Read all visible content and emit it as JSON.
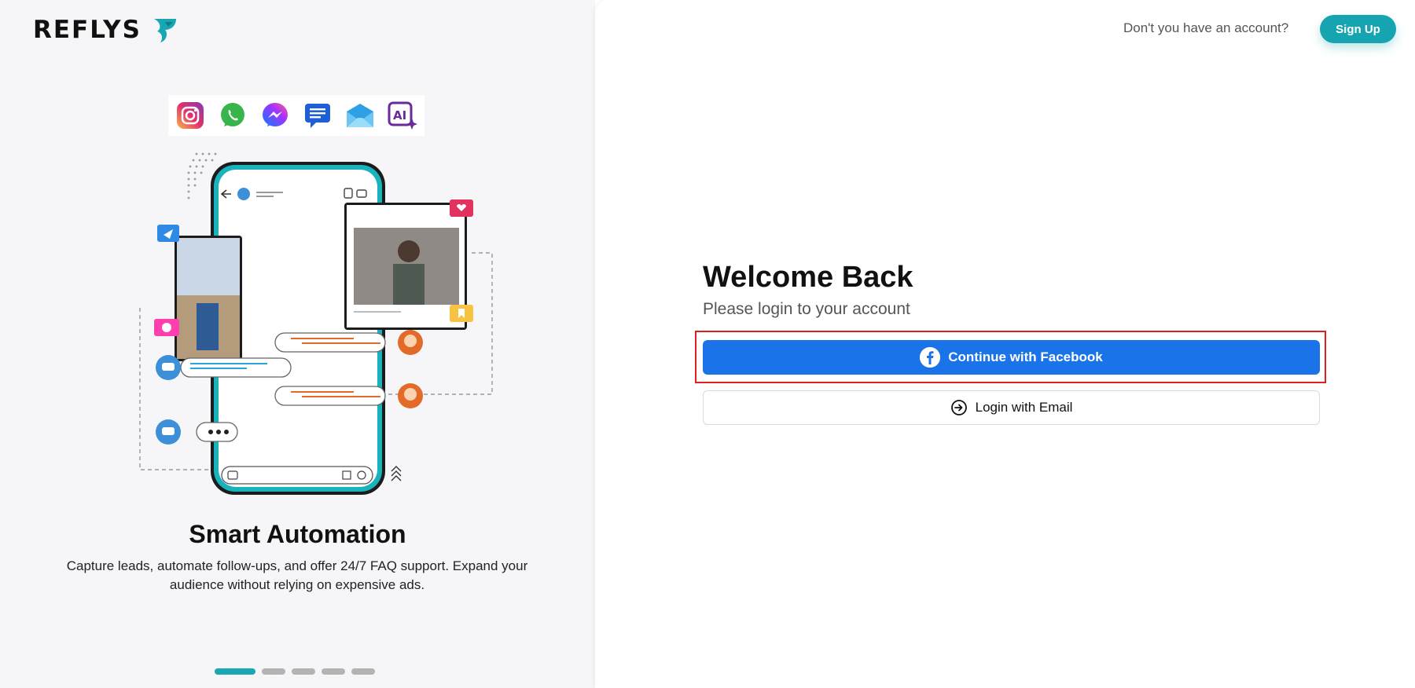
{
  "brand": {
    "name": "REFLYS"
  },
  "header": {
    "account_question": "Don't you have an account?",
    "signup_label": "Sign Up"
  },
  "channels": [
    "instagram-icon",
    "whatsapp-icon",
    "messenger-icon",
    "sms-icon",
    "email-icon",
    "ai-icon"
  ],
  "slide": {
    "title": "Smart Automation",
    "description": "Capture leads, automate follow-ups, and offer 24/7 FAQ support. Expand your audience without relying on expensive ads.",
    "total": 5,
    "active_index": 0
  },
  "login": {
    "title": "Welcome Back",
    "subtitle": "Please login to your account",
    "facebook_label": "Continue with Facebook",
    "email_label": "Login with Email"
  },
  "colors": {
    "brand_teal": "#16a4b0",
    "facebook_blue": "#1a73e8",
    "highlight_red": "#e02020"
  }
}
